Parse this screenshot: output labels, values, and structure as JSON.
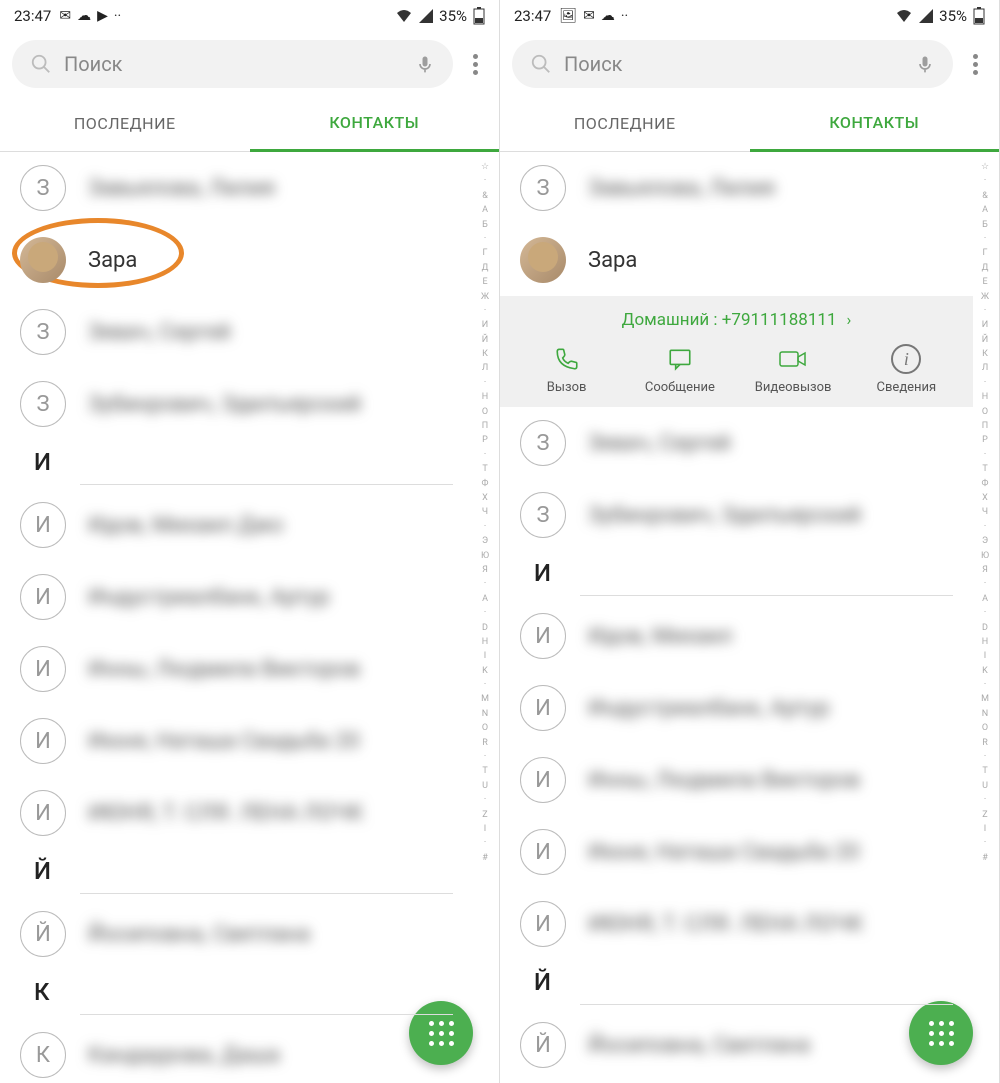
{
  "status": {
    "time": "23:47",
    "icons": [
      "mail",
      "cloud",
      "youtube",
      "more"
    ],
    "wifi": "wifi",
    "battery_percent": "35%",
    "signal": "signal"
  },
  "search": {
    "placeholder": "Поиск"
  },
  "tabs": {
    "recent": "ПОСЛЕДНИЕ",
    "contacts": "КОНТАКТЫ"
  },
  "alpha_index": [
    "☆",
    "·",
    "&",
    "А",
    "Б",
    "·",
    "Г",
    "Д",
    "Е",
    "Ж",
    "·",
    "И",
    "Й",
    "К",
    "Л",
    "·",
    "Н",
    "О",
    "П",
    "Р",
    "·",
    "Т",
    "Ф",
    "Х",
    "Ч",
    "·",
    "Э",
    "Ю",
    "Я",
    "·",
    "A",
    "·",
    "D",
    "H",
    "I",
    "K",
    "·",
    "M",
    "N",
    "O",
    "R",
    "·",
    "T",
    "U",
    "·",
    "Z",
    "I",
    "·",
    "#"
  ],
  "left": {
    "contacts": [
      {
        "avatar": "З",
        "name": "Завьялова, Лилия",
        "blur": true
      },
      {
        "avatar": "photo",
        "name": "Зара",
        "blur": false,
        "highlight": true
      },
      {
        "avatar": "З",
        "name": "Зевач, Сергей",
        "blur": true
      },
      {
        "avatar": "З",
        "name": "Зубинрович, Эдилъярский",
        "blur": true
      }
    ],
    "section_i": "И",
    "contacts_i": [
      {
        "avatar": "И",
        "name": "Идов, Михаил Джо",
        "blur": true
      },
      {
        "avatar": "И",
        "name": "Индустриалбанк, Артур",
        "blur": true
      },
      {
        "avatar": "И",
        "name": "Инны, Людмила Викторов",
        "blur": true
      },
      {
        "avatar": "И",
        "name": "Июня, Наташа Свадьба 20",
        "blur": true
      },
      {
        "avatar": "И",
        "name": "ИЮНЯ, Т. СЛЯ. ЛЕНА ЛОЧК",
        "blur": true
      }
    ],
    "section_j": "Й",
    "contacts_j": [
      {
        "avatar": "Й",
        "name": "Йосиповна, Светлана",
        "blur": true
      }
    ],
    "section_k": "К",
    "contacts_k": [
      {
        "avatar": "К",
        "name": "Кандаурова, Даша",
        "blur": true
      }
    ]
  },
  "right": {
    "contacts": [
      {
        "avatar": "З",
        "name": "Завьялова, Лилия",
        "blur": true
      },
      {
        "avatar": "photo",
        "name": "Зара",
        "blur": false
      }
    ],
    "expanded": {
      "phone_label": "Домашний",
      "phone_number": "+79111188111",
      "actions": {
        "call": "Вызов",
        "message": "Сообщение",
        "video": "Видеовызов",
        "info": "Сведения"
      }
    },
    "contacts_after": [
      {
        "avatar": "З",
        "name": "Зевач, Сергей",
        "blur": true
      },
      {
        "avatar": "З",
        "name": "Зубинрович, Эдилъярский",
        "blur": true
      }
    ],
    "section_i": "И",
    "contacts_i": [
      {
        "avatar": "И",
        "name": "Идов, Михаил",
        "blur": true
      },
      {
        "avatar": "И",
        "name": "Индустриалбанк, Артур",
        "blur": true
      },
      {
        "avatar": "И",
        "name": "Инны, Людмила Викторов",
        "blur": true
      },
      {
        "avatar": "И",
        "name": "Июня, Наташа Свадьба 20",
        "blur": true
      },
      {
        "avatar": "И",
        "name": "ИЮНЯ, Т. СЛЯ. ЛЕНА ЛОЧК",
        "blur": true
      }
    ],
    "section_j": "Й",
    "contacts_j": [
      {
        "avatar": "Й",
        "name": "Йосиповна, Светлана",
        "blur": true
      }
    ]
  }
}
